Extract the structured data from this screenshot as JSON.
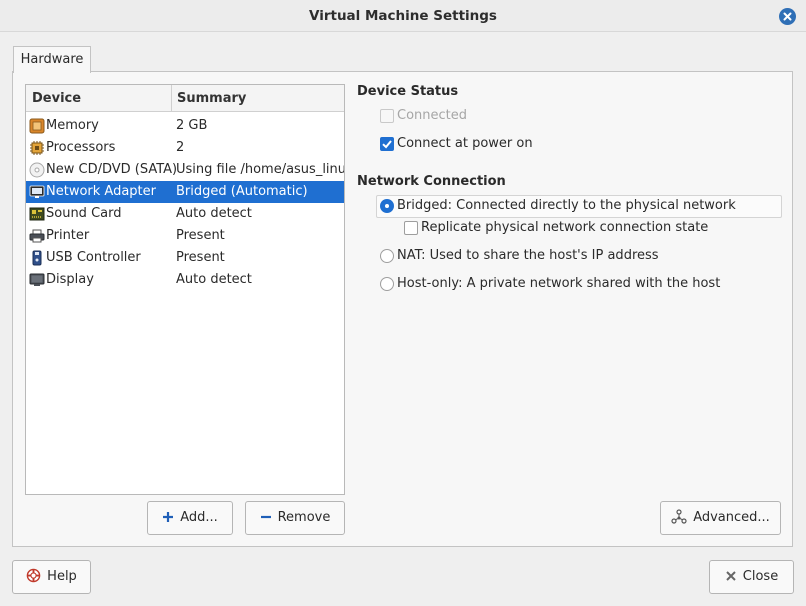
{
  "window": {
    "title": "Virtual Machine Settings"
  },
  "tabs": [
    {
      "label": "Hardware"
    }
  ],
  "device_list": {
    "columns": {
      "device": "Device",
      "summary": "Summary"
    },
    "rows": [
      {
        "name": "Memory",
        "summary": "2 GB",
        "icon": "memory-icon"
      },
      {
        "name": "Processors",
        "summary": "2",
        "icon": "processor-icon"
      },
      {
        "name": "New CD/DVD (SATA)",
        "summary": "Using file /home/asus_linux",
        "icon": "cd-dvd-icon"
      },
      {
        "name": "Network Adapter",
        "summary": "Bridged (Automatic)",
        "icon": "network-adapter-icon",
        "selected": true
      },
      {
        "name": "Sound Card",
        "summary": "Auto detect",
        "icon": "sound-card-icon"
      },
      {
        "name": "Printer",
        "summary": "Present",
        "icon": "printer-icon"
      },
      {
        "name": "USB Controller",
        "summary": "Present",
        "icon": "usb-icon"
      },
      {
        "name": "Display",
        "summary": "Auto detect",
        "icon": "display-icon"
      }
    ]
  },
  "buttons": {
    "add": "Add...",
    "remove": "Remove",
    "advanced": "Advanced...",
    "help": "Help",
    "close": "Close"
  },
  "device_status": {
    "title": "Device Status",
    "connected": {
      "label": "Connected",
      "checked": false,
      "disabled": true
    },
    "connect_at_power_on": {
      "label": "Connect at power on",
      "checked": true
    }
  },
  "network_connection": {
    "title": "Network Connection",
    "bridged": {
      "label": "Bridged: Connected directly to the physical network",
      "selected": true
    },
    "replicate": {
      "label": "Replicate physical network connection state",
      "checked": false
    },
    "nat": {
      "label": "NAT: Used to share the host's IP address",
      "selected": false
    },
    "host_only": {
      "label": "Host-only: A private network shared with the host",
      "selected": false
    }
  },
  "colors": {
    "accent": "#1f6fd1",
    "close_button": "#2f6fb6"
  }
}
